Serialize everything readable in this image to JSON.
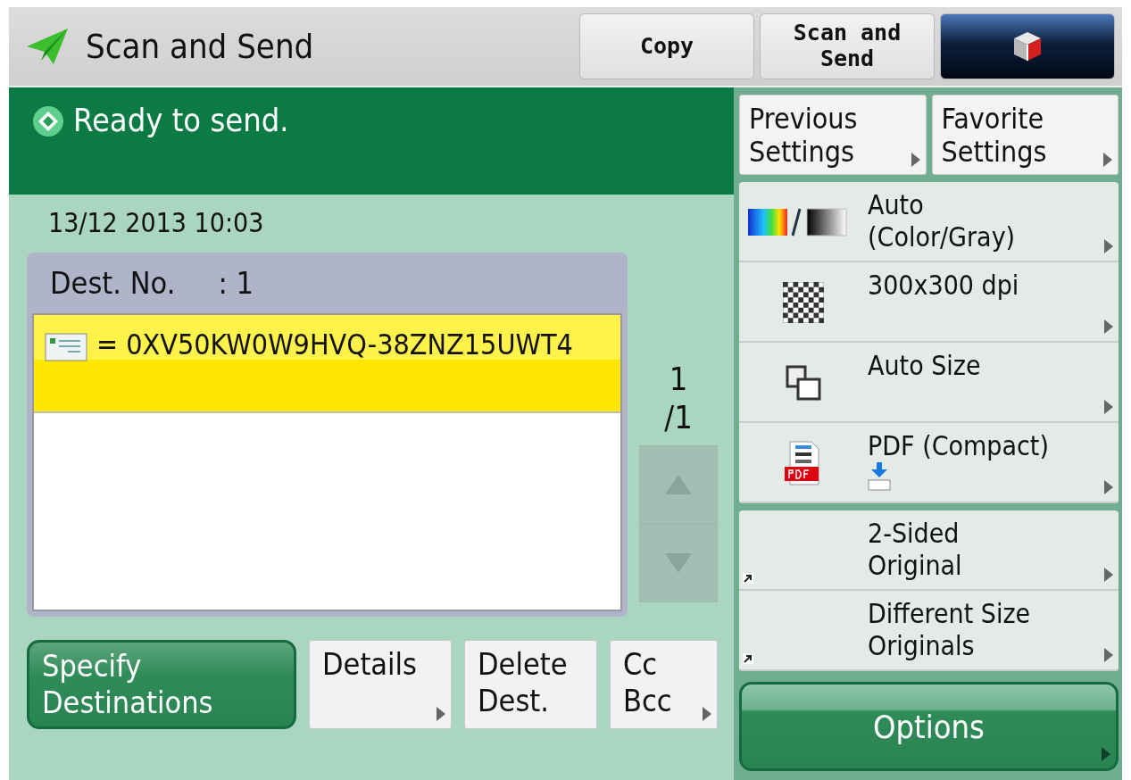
{
  "header": {
    "title": "Scan and Send",
    "tabs": [
      {
        "kind": "text",
        "label": "Copy"
      },
      {
        "kind": "text",
        "label": "Scan and\nSend"
      },
      {
        "kind": "home"
      }
    ]
  },
  "status": {
    "message": "Ready to send."
  },
  "date": "13/12 2013 10:03",
  "destinations": {
    "header_label": "Dest. No.",
    "count": ": 1",
    "rows": [
      {
        "address": "= 0XV50KW0W9HVQ-38ZNZ15UWT4",
        "selected": true
      }
    ],
    "page": "1",
    "pages": "/1",
    "scroll_disabled": true
  },
  "actions": [
    {
      "label": "Specify\nDestinations",
      "kind": "primary",
      "arrow": false
    },
    {
      "label": "Details",
      "kind": "secondary",
      "arrow": true
    },
    {
      "label": "Delete\nDest.",
      "kind": "secondary",
      "arrow": false
    },
    {
      "label": "Cc\nBcc",
      "kind": "secondary",
      "arrow": true
    }
  ],
  "quick": [
    {
      "label": "Previous\nSettings",
      "arrow": true
    },
    {
      "label": "Favorite\nSettings",
      "arrow": true
    }
  ],
  "settings": [
    [
      {
        "kind": "color-mode",
        "label": "Auto\n(Color/Gray)"
      },
      {
        "kind": "resolution",
        "label": "300x300 dpi"
      },
      {
        "kind": "size",
        "label": "Auto Size"
      },
      {
        "kind": "format",
        "label": "PDF (Compact)"
      }
    ],
    [
      {
        "kind": "shortcut",
        "label": "2-Sided\nOriginal"
      },
      {
        "kind": "shortcut",
        "label": "Different Size\nOriginals"
      }
    ]
  ],
  "options": {
    "label": "Options",
    "arrow": true
  }
}
